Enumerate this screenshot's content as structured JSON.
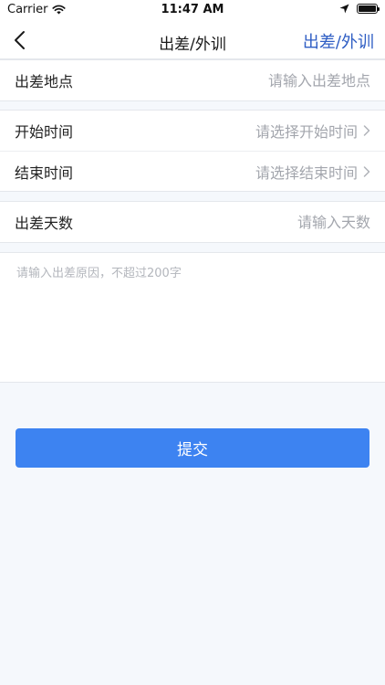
{
  "status_bar": {
    "carrier": "Carrier",
    "time": "11:47 AM",
    "wifi_icon": "wifi-icon",
    "location_icon": "location-arrow-icon",
    "battery_icon": "battery-full-icon"
  },
  "nav": {
    "title": "出差/外训",
    "right_action": "出差/外训",
    "back_icon": "chevron-left-icon",
    "accent_color": "#2f5ec4"
  },
  "form": {
    "location": {
      "label": "出差地点",
      "placeholder": "请输入出差地点"
    },
    "start_time": {
      "label": "开始时间",
      "placeholder": "请选择开始时间"
    },
    "end_time": {
      "label": "结束时间",
      "placeholder": "请选择结束时间"
    },
    "days": {
      "label": "出差天数",
      "placeholder": "请输入天数"
    },
    "reason": {
      "placeholder": "请输入出差原因，不超过200字"
    }
  },
  "submit": {
    "label": "提交",
    "color": "#3d83f1"
  }
}
